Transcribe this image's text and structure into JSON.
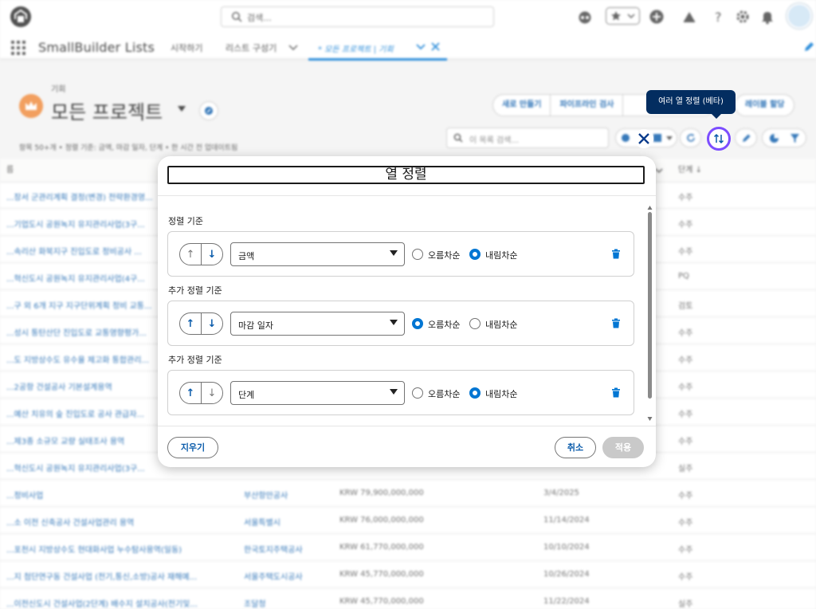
{
  "header": {
    "search_placeholder": "검색..."
  },
  "nav": {
    "app_name": "SmallBuilder Lists",
    "tabs": [
      {
        "label": "시작하기"
      },
      {
        "label": "리스트 구성기"
      },
      {
        "label": "* 모든 프로젝트 | 기회"
      }
    ]
  },
  "list": {
    "object_label": "기회",
    "title": "모든 프로젝트",
    "meta": "항목 50+개 • 정렬 기준: 금액, 마감 일자, 단계 • 한 시간 전 업데이트됨",
    "buttons": [
      "새로 만들기",
      "파이프라인 검사"
    ],
    "assign_label": "레이블 할당",
    "tooltip": "여러 열 정렬 (베타)",
    "search_placeholder": "이 목록 검색...",
    "col_first_partial": "름",
    "col_stage": "단계 ↓"
  },
  "rows": [
    {
      "name": "...장서 군관리계획 결정(변경) 전략환경영...",
      "account": "",
      "amount": "",
      "date": "",
      "stage": "수주"
    },
    {
      "name": "...기업도시 공원녹지 유지관리사업(3구...",
      "account": "",
      "amount": "",
      "date": "",
      "stage": "수주"
    },
    {
      "name": "...속리산 화북지구 진입도로 정비공사 ...",
      "account": "",
      "amount": "",
      "date": "",
      "stage": "수주"
    },
    {
      "name": "...혁신도시 공원녹지 유지관리사업(4구...",
      "account": "",
      "amount": "",
      "date": "",
      "stage": "PQ"
    },
    {
      "name": "...구 외 6개 지구 지구단위계획 정비 교통...",
      "account": "",
      "amount": "",
      "date": "",
      "stage": "검토"
    },
    {
      "name": "...성시 통탄산단 진입도로 교통영향평가...",
      "account": "",
      "amount": "",
      "date": "",
      "stage": "수주"
    },
    {
      "name": "...도 지방상수도 유수율 제고화 통합관리...",
      "account": "",
      "amount": "",
      "date": "",
      "stage": "수주"
    },
    {
      "name": "...2공항 건설공사 기본설계용역",
      "account": "",
      "amount": "",
      "date": "",
      "stage": "수주"
    },
    {
      "name": "...예산 치유의 숲 진입도로 공사 관급자...",
      "account": "",
      "amount": "",
      "date": "",
      "stage": "수주"
    },
    {
      "name": "...제3종 소규모 교량 실태조사 용역",
      "account": "",
      "amount": "",
      "date": "",
      "stage": "수주"
    },
    {
      "name": "...혁신도시 공원녹지 유지관리사업(3구...",
      "account": "",
      "amount": "",
      "date": "",
      "stage": "실주"
    },
    {
      "name": "...정비사업",
      "account": "부산항만공사",
      "amount": "KRW 79,900,000,000",
      "date": "3/4/2025",
      "stage": "수주"
    },
    {
      "name": "...소 이전 신축공사 건설사업관리 용역",
      "account": "서울특별시",
      "amount": "KRW 76,000,000,000",
      "date": "11/14/2024",
      "stage": "수주"
    },
    {
      "name": "...포천시 지방상수도 현대화사업 누수탐사용역(일동)",
      "account": "한국토지주택공사",
      "amount": "KRW 61,770,000,000",
      "date": "10/10/2024",
      "stage": "수주"
    },
    {
      "name": "...지 첨단연구동 건설사업 (전기,통신,소방)공사 재해예...",
      "account": "서울주택도시공사",
      "amount": "KRW 45,770,000,000",
      "date": "10/26/2024",
      "stage": "수주"
    },
    {
      "name": "...이전신도시 건설사업(2단계) 배수지 설치공사(전기및...",
      "account": "조달청",
      "amount": "KRW 45,770,000,000",
      "date": "11/22/2024",
      "stage": "실주"
    }
  ],
  "modal": {
    "title": "열 정렬",
    "sort_label": "정렬 기준",
    "add_sort_label": "추가 정렬 기준",
    "asc_label": "오름차순",
    "desc_label": "내림차순",
    "rules": [
      {
        "field": "금액",
        "direction": "내림차순"
      },
      {
        "field": "마감 일자",
        "direction": "오름차순"
      },
      {
        "field": "단계",
        "direction": "내림차순"
      }
    ],
    "clear_label": "지우기",
    "cancel_label": "취소",
    "apply_label": "적용"
  },
  "colors": {
    "brand_blue": "#0176d3",
    "link_blue": "#0b5cab",
    "tooltip_bg": "#032d60",
    "focus_purple": "#7c4dff"
  }
}
